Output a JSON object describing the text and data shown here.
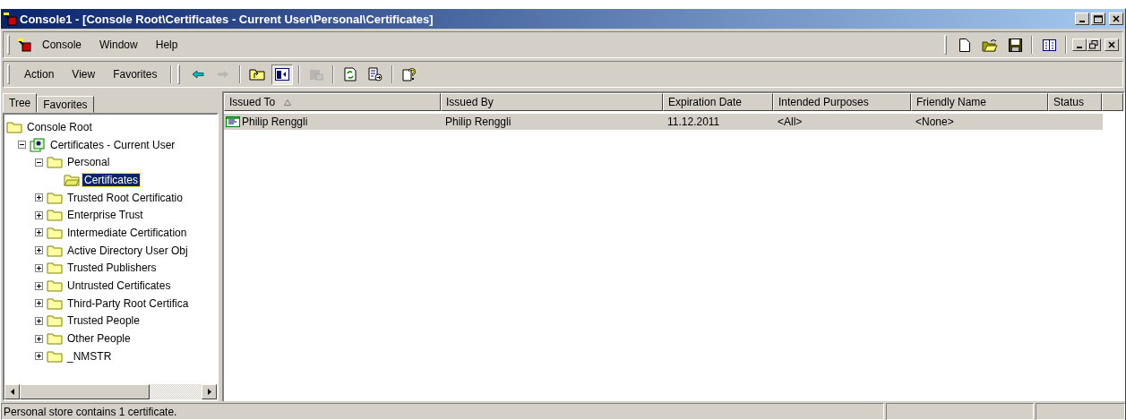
{
  "window": {
    "title": "Console1 - [Console Root\\Certificates - Current User\\Personal\\Certificates]"
  },
  "menu_bar": {
    "items": [
      "Console",
      "Window",
      "Help"
    ],
    "buttons": [
      {
        "kind": "new",
        "disabled": false
      },
      {
        "kind": "open",
        "disabled": false
      },
      {
        "kind": "save",
        "disabled": false
      },
      {
        "kind": "columns",
        "disabled": false
      }
    ]
  },
  "toolbar": {
    "menus": [
      "Action",
      "View",
      "Favorites"
    ],
    "buttons": [
      {
        "kind": "back",
        "disabled": false,
        "pressed": false
      },
      {
        "kind": "forward",
        "disabled": true,
        "pressed": false
      },
      {
        "kind": "sep"
      },
      {
        "kind": "up",
        "disabled": false,
        "pressed": false
      },
      {
        "kind": "tree",
        "disabled": false,
        "pressed": true
      },
      {
        "kind": "sep"
      },
      {
        "kind": "delete",
        "disabled": true,
        "pressed": false
      },
      {
        "kind": "sep"
      },
      {
        "kind": "refresh",
        "disabled": false,
        "pressed": false
      },
      {
        "kind": "export",
        "disabled": false,
        "pressed": false
      },
      {
        "kind": "sep"
      },
      {
        "kind": "help",
        "disabled": false,
        "pressed": false
      }
    ]
  },
  "tabs": [
    {
      "label": "Tree",
      "selected": true
    },
    {
      "label": "Favorites",
      "selected": false
    }
  ],
  "tree": [
    {
      "label": "Console Root",
      "kind": "folder",
      "selected": false,
      "children": [
        {
          "label": "Certificates - Current User",
          "kind": "store",
          "expanded": true,
          "selected": false,
          "children": [
            {
              "label": "Personal",
              "kind": "folder",
              "expanded": true,
              "selected": false,
              "children": [
                {
                  "label": "Certificates",
                  "kind": "folder",
                  "selected": true
                }
              ]
            },
            {
              "label": "Trusted Root Certificatio",
              "kind": "folder",
              "expanded": false,
              "selected": false
            },
            {
              "label": "Enterprise Trust",
              "kind": "folder",
              "expanded": false,
              "selected": false
            },
            {
              "label": "Intermediate Certification",
              "kind": "folder",
              "expanded": false,
              "selected": false
            },
            {
              "label": "Active Directory User Obj",
              "kind": "folder",
              "expanded": false,
              "selected": false
            },
            {
              "label": "Trusted Publishers",
              "kind": "folder",
              "expanded": false,
              "selected": false
            },
            {
              "label": "Untrusted Certificates",
              "kind": "folder",
              "expanded": false,
              "selected": false
            },
            {
              "label": "Third-Party Root Certifica",
              "kind": "folder",
              "expanded": false,
              "selected": false
            },
            {
              "label": "Trusted People",
              "kind": "folder",
              "expanded": false,
              "selected": false
            },
            {
              "label": "Other People",
              "kind": "folder",
              "expanded": false,
              "selected": false
            },
            {
              "label": "_NMSTR",
              "kind": "folder",
              "expanded": false,
              "selected": false
            }
          ]
        }
      ]
    }
  ],
  "table": {
    "columns": [
      {
        "label": "Issued To",
        "sort_ascending": true
      },
      {
        "label": "Issued By"
      },
      {
        "label": "Expiration Date"
      },
      {
        "label": "Intended Purposes"
      },
      {
        "label": "Friendly Name"
      },
      {
        "label": "Status"
      }
    ],
    "rows": [
      {
        "selected": true,
        "cells": [
          "Philip Renggli",
          "Philip Renggli",
          "11.12.2011",
          "<All>",
          "<None>",
          ""
        ]
      }
    ]
  },
  "status_bar": {
    "text": "Personal store contains 1 certificate."
  }
}
